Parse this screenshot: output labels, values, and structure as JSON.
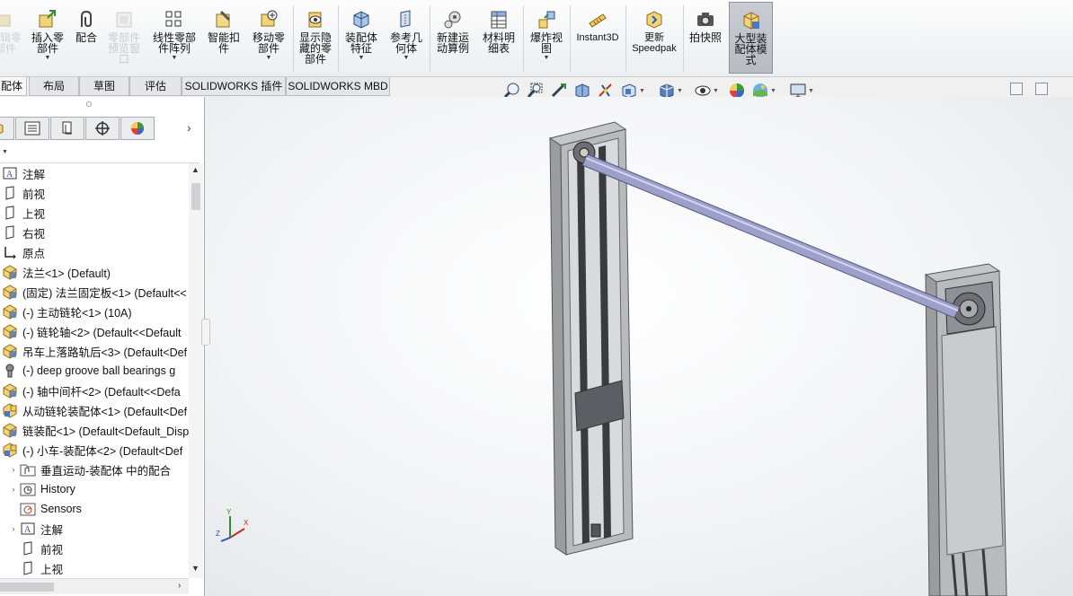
{
  "ribbon": {
    "buttons": [
      {
        "label": "插入零\n部件",
        "icon": "insert-component-icon"
      },
      {
        "label": "配合",
        "icon": "mate-icon"
      },
      {
        "label": "零部件\n预览窗\n口",
        "icon": "component-preview-icon",
        "disabled": true
      },
      {
        "label": "线性零部\n件阵列",
        "icon": "linear-pattern-icon"
      },
      {
        "label": "智能扣\n件",
        "icon": "smart-fasteners-icon"
      },
      {
        "label": "移动零\n部件",
        "icon": "move-component-icon"
      },
      {
        "label": "显示隐\n藏的零\n部件",
        "icon": "show-hidden-icon"
      },
      {
        "label": "装配体\n特征",
        "icon": "assembly-features-icon"
      },
      {
        "label": "参考几\n何体",
        "icon": "reference-geometry-icon"
      },
      {
        "label": "新建运\n动算例",
        "icon": "motion-study-icon"
      },
      {
        "label": "材料明\n细表",
        "icon": "bom-icon"
      },
      {
        "label": "爆炸视\n图",
        "icon": "exploded-view-icon"
      },
      {
        "label": "Instant3D",
        "icon": "instant3d-icon"
      },
      {
        "label": "更新\nSpeedpak",
        "icon": "speedpak-icon"
      },
      {
        "label": "拍快照",
        "icon": "snapshot-icon"
      },
      {
        "label": "大型装\n配体模\n式",
        "icon": "large-assembly-icon",
        "active": true
      }
    ],
    "partial_left_label": "编辑零\n部件"
  },
  "tabs": [
    {
      "label": "配体"
    },
    {
      "label": "布局"
    },
    {
      "label": "草图"
    },
    {
      "label": "评估"
    },
    {
      "label": "SOLIDWORKS 插件"
    },
    {
      "label": "SOLIDWORKS MBD"
    }
  ],
  "tree": {
    "items": [
      {
        "label": "注解",
        "icon": "annotations-icon"
      },
      {
        "label": "前视",
        "icon": "plane-icon"
      },
      {
        "label": "上视",
        "icon": "plane-icon"
      },
      {
        "label": "右视",
        "icon": "plane-icon"
      },
      {
        "label": "原点",
        "icon": "origin-icon"
      },
      {
        "label": "法兰<1> (Default)",
        "icon": "part-icon"
      },
      {
        "label": "(固定) 法兰固定板<1> (Default<<",
        "icon": "part-icon"
      },
      {
        "label": "(-) 主动链轮<1> (10A)",
        "icon": "part-icon"
      },
      {
        "label": "(-) 链轮轴<2> (Default<<Default",
        "icon": "part-icon"
      },
      {
        "label": "吊车上落路轨后<3> (Default<Def",
        "icon": "part-icon"
      },
      {
        "label": "(-) deep groove ball bearings g",
        "icon": "toolbox-part-icon"
      },
      {
        "label": "(-) 轴中间杆<2> (Default<<Defa",
        "icon": "part-icon"
      },
      {
        "label": "从动链轮装配体<1> (Default<Def",
        "icon": "subassembly-icon"
      },
      {
        "label": "链装配<1> (Default<Default_Disp",
        "icon": "part-icon"
      },
      {
        "label": "(-) 小车-装配体<2> (Default<Def",
        "icon": "subassembly-icon"
      },
      {
        "label": "垂直运动-装配体 中的配合",
        "icon": "mates-folder-icon"
      },
      {
        "label": "History",
        "icon": "history-icon"
      },
      {
        "label": "Sensors",
        "icon": "sensors-icon"
      },
      {
        "label": "注解",
        "icon": "annotations-icon"
      },
      {
        "label": "前视",
        "icon": "plane-icon"
      },
      {
        "label": "上视",
        "icon": "plane-icon"
      }
    ]
  },
  "triad": {
    "x": "X",
    "y": "Y",
    "z": "Z"
  },
  "colors": {
    "accent": "#1c64c8",
    "frame": "#8e9196",
    "rod": "#9ea0cc",
    "carriage": "#5c5e63"
  }
}
